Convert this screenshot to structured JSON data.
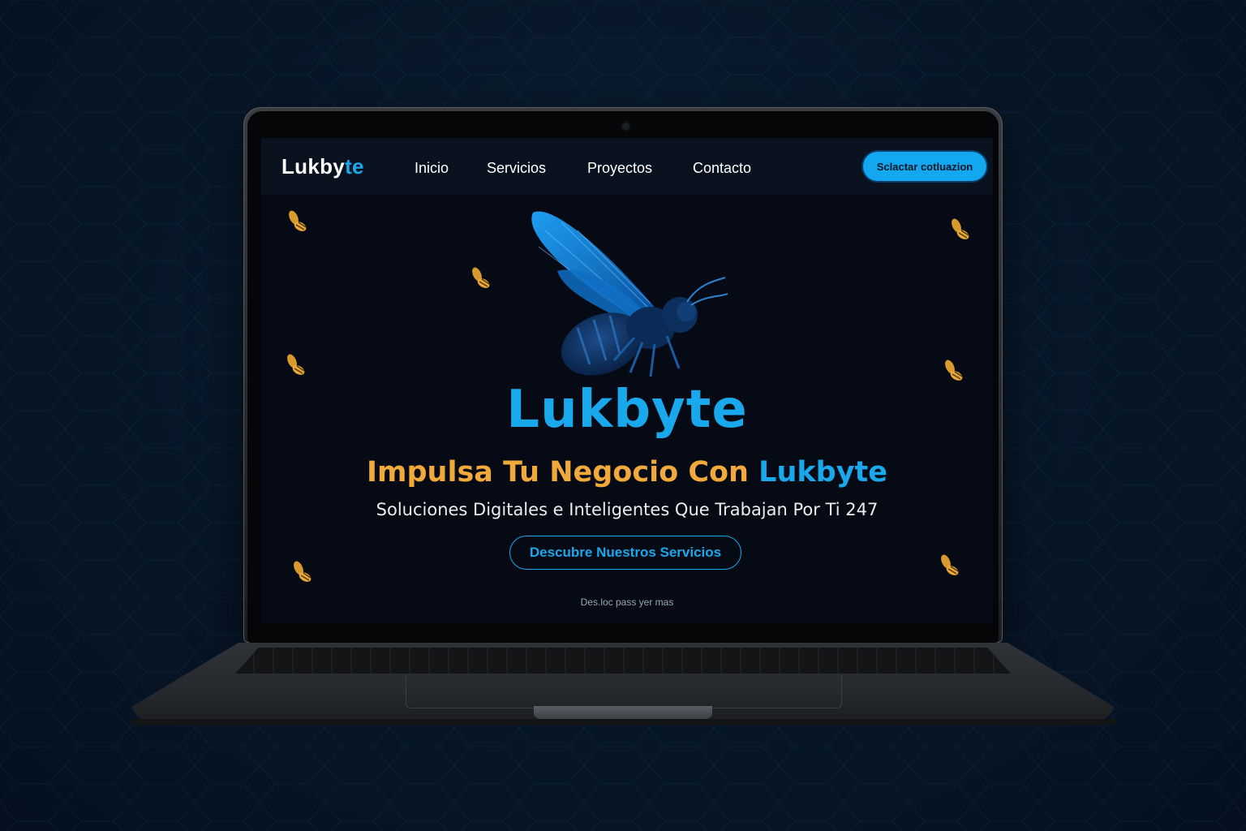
{
  "nav": {
    "logo_main": "Lukby",
    "logo_accent": "te",
    "links": [
      "Inicio",
      "Servicios",
      "Proyectos",
      "Contacto"
    ],
    "cta_label": "Sclactar cotluazion"
  },
  "hero": {
    "brand": "Lukbyte",
    "headline_main": "Impulsa Tu Negocio Con ",
    "headline_accent": "Lukbyte",
    "subheadline": "Soluciones Digitales e Inteligentes Que Trabajan Por Ti 247",
    "button_label": "Descubre Nuestros Servicios",
    "scroll_hint": "Des.loc pass yer mas"
  },
  "colors": {
    "accent_blue": "#1aa8ec",
    "accent_orange": "#f2a93b",
    "screen_bg": "#050a14",
    "page_bg": "#071627"
  },
  "icons": {
    "hero": "bee-icon",
    "decor": "small-bee-icon"
  }
}
